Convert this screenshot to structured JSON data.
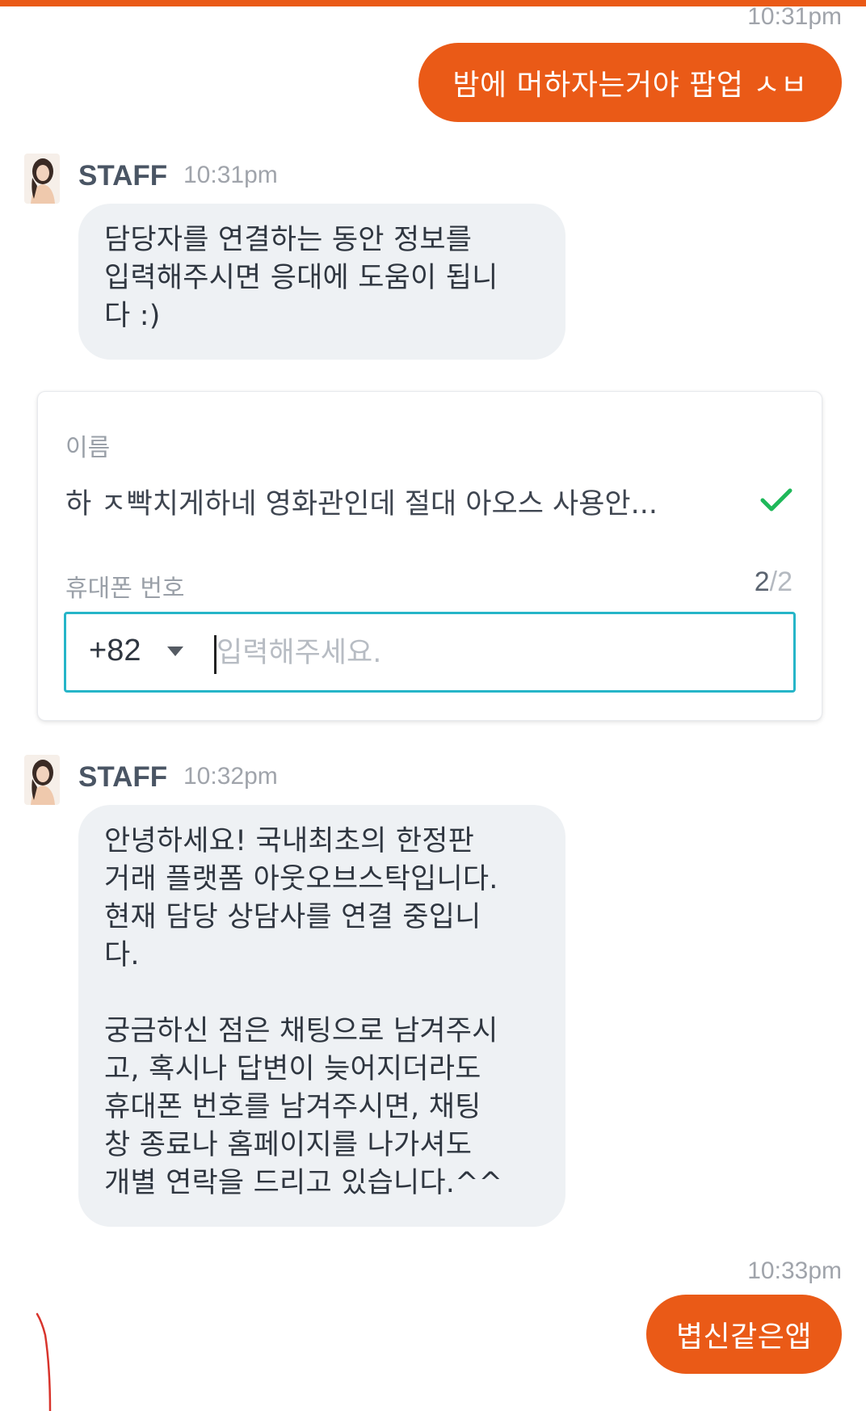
{
  "messages": {
    "m1": {
      "time": "10:31pm",
      "text": "밤에 머하자는거야 팝업 ㅅㅂ"
    },
    "m2": {
      "sender": "STAFF",
      "time": "10:31pm",
      "text": "담당자를 연결하는 동안 정보를\n입력해주시면 응대에 도움이 됩니\n다 :)"
    },
    "m3": {
      "sender": "STAFF",
      "time": "10:32pm",
      "text": "안녕하세요! 국내최초의 한정판\n거래 플랫폼 아웃오브스탁입니다.\n현재 담당 상담사를 연결 중입니\n다.\n\n궁금하신 점은 채팅으로 남겨주시\n고, 혹시나 답변이 늦어지더라도\n휴대폰 번호를 남겨주시면, 채팅\n창 종료나 홈페이지를 나가셔도\n개별 연락을 드리고 있습니다.^^"
    },
    "m4": {
      "time": "10:33pm",
      "text": "볍신같은앱"
    }
  },
  "form": {
    "name_label": "이름",
    "name_value": "하 ㅈ빡치게하네 영화관인데 절대 아오스 사용안...",
    "phone_label": "휴대폰 번호",
    "step_current": "2",
    "step_sep": "/",
    "step_total": "2",
    "country_code": "+82",
    "phone_placeholder": "입력해주세요."
  },
  "icons": {
    "check": "check-icon",
    "dropdown": "caret-down-icon",
    "avatar": "staff-avatar"
  },
  "colors": {
    "accent": "#ea5a17",
    "staff_bubble": "#eef1f4",
    "input_focus": "#26b5c8",
    "check": "#1fb85a"
  }
}
